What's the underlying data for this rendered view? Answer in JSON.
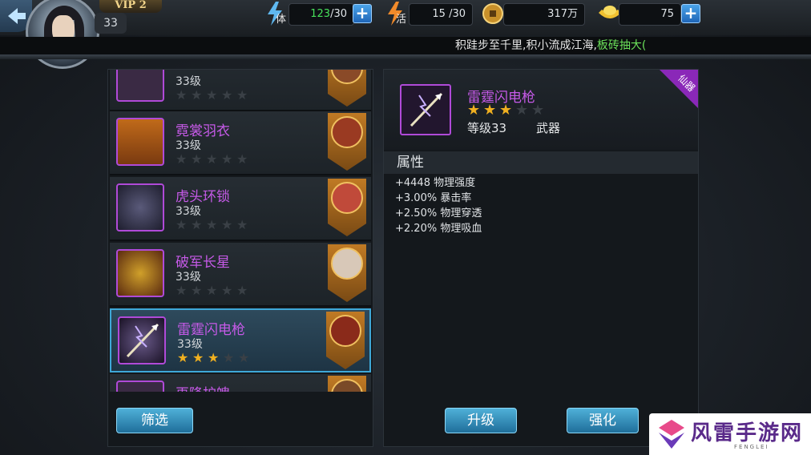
{
  "player": {
    "vip": "VIP 2",
    "level": "33"
  },
  "resources": {
    "stamina": {
      "label": "体",
      "current": "123",
      "max": "/30",
      "value_text": "123 /30"
    },
    "vitality": {
      "label": "活",
      "value_text": "15 /30"
    },
    "coins": {
      "value_text": "317万"
    },
    "gold": {
      "value_text": "75"
    }
  },
  "marquee": {
    "text": "积跬步至千里,积小流成江海,",
    "highlight": "板砖抽大("
  },
  "equipment_list": {
    "items": [
      {
        "name": "",
        "level": "33级",
        "stars": 0
      },
      {
        "name": "霓裳羽衣",
        "level": "33级",
        "stars": 0
      },
      {
        "name": "虎头环锁",
        "level": "33级",
        "stars": 0
      },
      {
        "name": "破军长星",
        "level": "33级",
        "stars": 0
      },
      {
        "name": "雷霆闪电枪",
        "level": "33级",
        "stars": 3,
        "selected": true
      },
      {
        "name": "再降护魄",
        "level": "",
        "stars": 0
      }
    ],
    "filter_button": "筛选"
  },
  "detail": {
    "name": "雷霆闪电枪",
    "stars": 3,
    "max_stars": 5,
    "level": "等级33",
    "type": "武器",
    "tag": "仙器",
    "attr_title": "属性",
    "attributes": [
      "+4448 物理强度",
      "+3.00% 暴击率",
      "+2.50% 物理穿透",
      "+2.20% 物理吸血"
    ],
    "upgrade_button": "升级",
    "enhance_button": "强化"
  },
  "watermark": {
    "text": "风雷手游网",
    "sub": "FENGLEI"
  },
  "colors": {
    "epic_purple": "#c65ae8",
    "star_gold": "#f0b020",
    "button_blue": "#2f88b8"
  }
}
